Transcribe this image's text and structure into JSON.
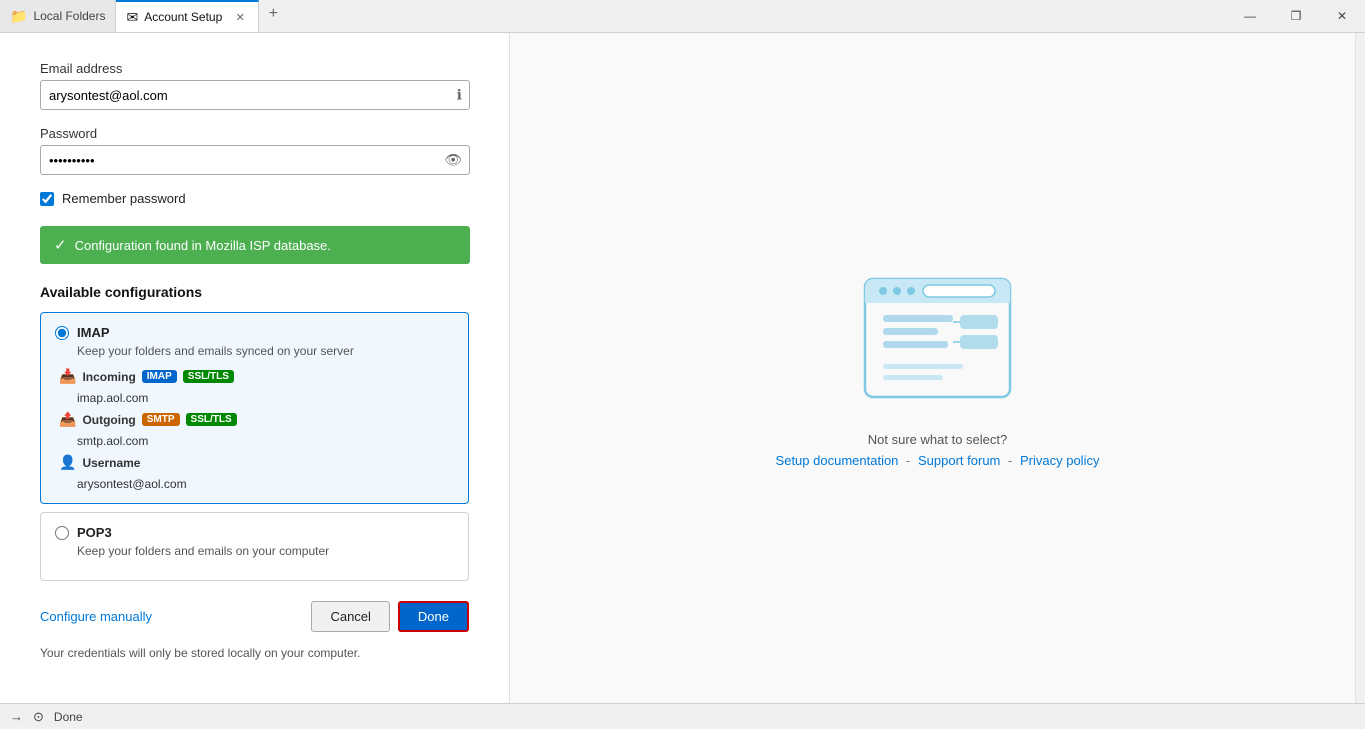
{
  "titlebar": {
    "tab1": {
      "label": "Local Folders",
      "icon": "📁",
      "active": false
    },
    "tab2": {
      "label": "Account Setup",
      "icon": "✉",
      "active": true
    },
    "window_controls": {
      "minimize": "—",
      "maximize": "❐",
      "close": "✕"
    }
  },
  "form": {
    "email_label": "Email address",
    "email_value": "arysontest@aol.com",
    "email_placeholder": "",
    "password_label": "Password",
    "password_value": "••••••••••",
    "remember_label": "Remember password"
  },
  "success_banner": {
    "text": "Configuration found in Mozilla ISP database."
  },
  "configurations": {
    "title": "Available configurations",
    "imap": {
      "label": "IMAP",
      "description": "Keep your folders and emails synced on your server",
      "incoming_label": "Incoming",
      "incoming_badge1": "IMAP",
      "incoming_badge2": "SSL/TLS",
      "incoming_server": "imap.aol.com",
      "outgoing_label": "Outgoing",
      "outgoing_badge1": "SMTP",
      "outgoing_badge2": "SSL/TLS",
      "outgoing_server": "smtp.aol.com",
      "username_label": "Username",
      "username_value": "arysontest@aol.com"
    },
    "pop3": {
      "label": "POP3",
      "description": "Keep your folders and emails on your computer"
    }
  },
  "actions": {
    "configure_manually": "Configure manually",
    "cancel": "Cancel",
    "done": "Done"
  },
  "footer": {
    "note": "Your credentials will only be stored locally on your computer."
  },
  "right_panel": {
    "not_sure": "Not sure what to select?",
    "link1": "Setup documentation",
    "separator1": "-",
    "link2": "Support forum",
    "separator2": "-",
    "link3": "Privacy policy"
  },
  "statusbar": {
    "label": "Done"
  }
}
